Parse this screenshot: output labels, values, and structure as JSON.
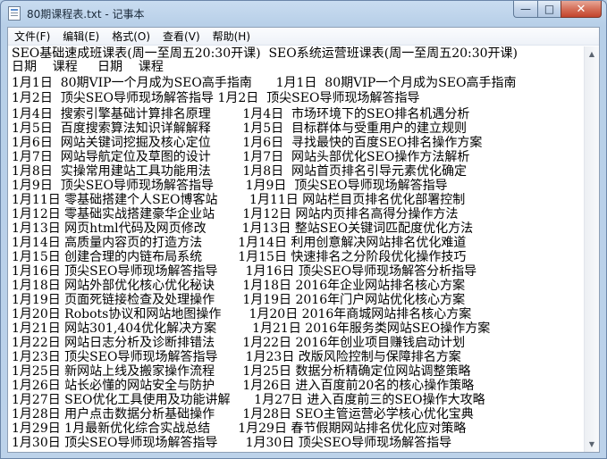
{
  "window": {
    "title": "80期课程表.txt - 记事本"
  },
  "caption": {
    "minimize": "—",
    "maximize": "□",
    "close": "✕"
  },
  "menu": [
    "文件(F)",
    "编辑(E)",
    "格式(O)",
    "查看(V)",
    "帮助(H)"
  ],
  "scrollbar": {
    "up_glyph": "▲",
    "down_glyph": "▼"
  },
  "lines": [
    "SEO基础速成班课表(周一至周五20:30开课)  SEO系统运营班课表(周一至周五20:30开课)",
    "日期    课程     日期    课程",
    "1月1日  80期VIP一个月成为SEO高手指南      1月1日  80期VIP一个月成为SEO高手指南",
    "1月2日  顶尖SEO导师现场解答指导 1月2日  顶尖SEO导师现场解答指导",
    "1月4日  搜索引擎基础计算排名原理        1月4日  市场环境下的SEO排名机遇分析",
    "1月5日  百度搜索算法知识详解解释        1月5日  目标群体与受重用户的建立规则",
    "1月6日  网站关键词挖掘及核心定位        1月6日  寻找最快的百度SEO排名操作方案",
    "1月7日  网站导航定位及草图的设计        1月7日  网站头部优化SEO操作方法解析",
    "1月8日  实操常用建站工具功能用法        1月8日  网站首页排名引导元素优化确定",
    "1月9日  顶尖SEO导师现场解答指导        1月9日  顶尖SEO导师现场解答指导",
    "1月11日 零基础搭建个人SEO博客站        1月11日 网站栏目页排名优化部署控制",
    "1月12日 零基础实战搭建豪华企业站       1月12日 网站内页排名高得分操作方法",
    "1月13日 网页html代码及网页修改         1月13日 整站SEO关键词匹配度优化方法",
    "1月14日 高质量内容页的打造方法         1月14日 利用创意解决网站排名优化难道",
    "1月15日 创建合理的内链布局系统         1月15日 快速排名之分阶段优化操作技巧",
    "1月16日 顶尖SEO导师现场解答指导       1月16日 顶尖SEO导师现场解答分析指导",
    "1月18日 网站外部优化核心优化秘诀       1月18日 2016年企业网站排名核心方案",
    "1月19日 页面死链接检查及处理操作       1月19日 2016年门户网站优化核心方案",
    "1月20日 Robots协议和网站地图操作       1月20日 2016年商城网站排名核心方案",
    "1月21日 网站301,404优化解决方案         1月21日 2016年服务类网站SEO操作方案",
    "1月22日 网站日志分析及诊断排错法       1月22日 2016年创业项目赚钱启动计划",
    "1月23日 顶尖SEO导师现场解答指导       1月23日 改版风险控制与保障排名方案",
    "1月25日 新网站上线及搬家操作流程       1月25日 数据分析精确定位网站调整策略",
    "1月26日 站长必懂的网站安全与防护       1月26日 进入百度前20名的核心操作策略",
    "1月27日 SEO优化工具使用及功能讲解      1月27日 进入百度前三的SEO操作大攻略",
    "1月28日 用户点击数据分析基础操作       1月28日 SEO主管运营必学核心优化宝典",
    "1月29日 1月最新优化综合实战总结       1月29日 春节假期网站排名优化应对策略",
    "1月30日 顶尖SEO导师现场解答指导       1月30日 顶尖SEO导师现场解答指导"
  ]
}
